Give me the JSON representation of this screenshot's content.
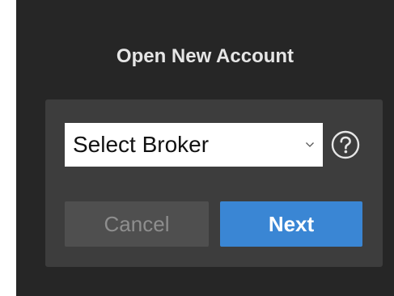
{
  "dialog": {
    "title": "Open New Account",
    "broker_select": {
      "selected_value": "Select Broker"
    },
    "help_icon": "question-circle",
    "buttons": {
      "cancel_label": "Cancel",
      "next_label": "Next"
    }
  },
  "colors": {
    "dialog_background": "#262626",
    "panel_background": "#3d3d3d",
    "title_text": "#e6e6e6",
    "primary_button": "#3a86d4",
    "disabled_button": "#4f4f4f",
    "disabled_button_text": "#8e8e8e"
  }
}
